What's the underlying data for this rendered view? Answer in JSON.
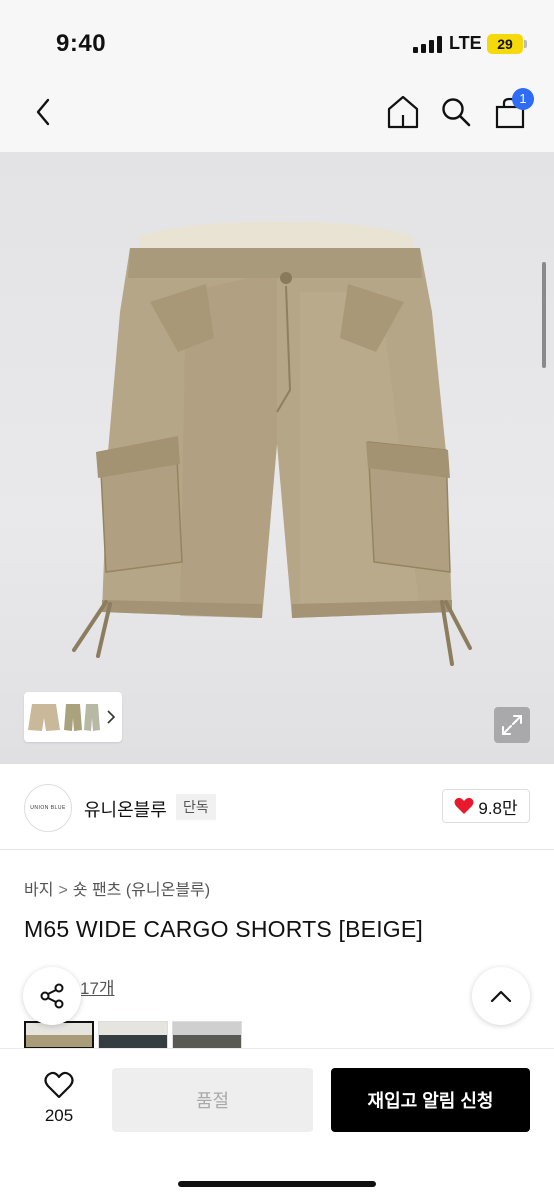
{
  "status_bar": {
    "time": "9:40",
    "network": "LTE",
    "battery": "29"
  },
  "nav": {
    "cart_count": "1"
  },
  "brand": {
    "logo_text": "UNION BLUE",
    "name": "유니온블루",
    "badge": "단독",
    "likes": "9.8만"
  },
  "breadcrumb": {
    "category": "바지",
    "separator": ">",
    "subcategory": "숏 팬츠 (유니온블루)"
  },
  "product": {
    "title": "M65 WIDE CARGO SHORTS [BEIGE]",
    "review_link": "후기 17개"
  },
  "bottom_bar": {
    "wish_count": "205",
    "sold_out_label": "품절",
    "restock_label": "재입고 알림 신청"
  },
  "colors": {
    "accent_blue": "#2f6cf5",
    "heart_red": "#e8192c",
    "shorts_beige": "#b4a485",
    "star_yellow": "#f3c12a"
  },
  "icons": [
    "back-icon",
    "home-icon",
    "search-icon",
    "cart-icon",
    "chevron-right-icon",
    "expand-icon",
    "heart-icon",
    "share-icon",
    "chevron-up-icon"
  ]
}
